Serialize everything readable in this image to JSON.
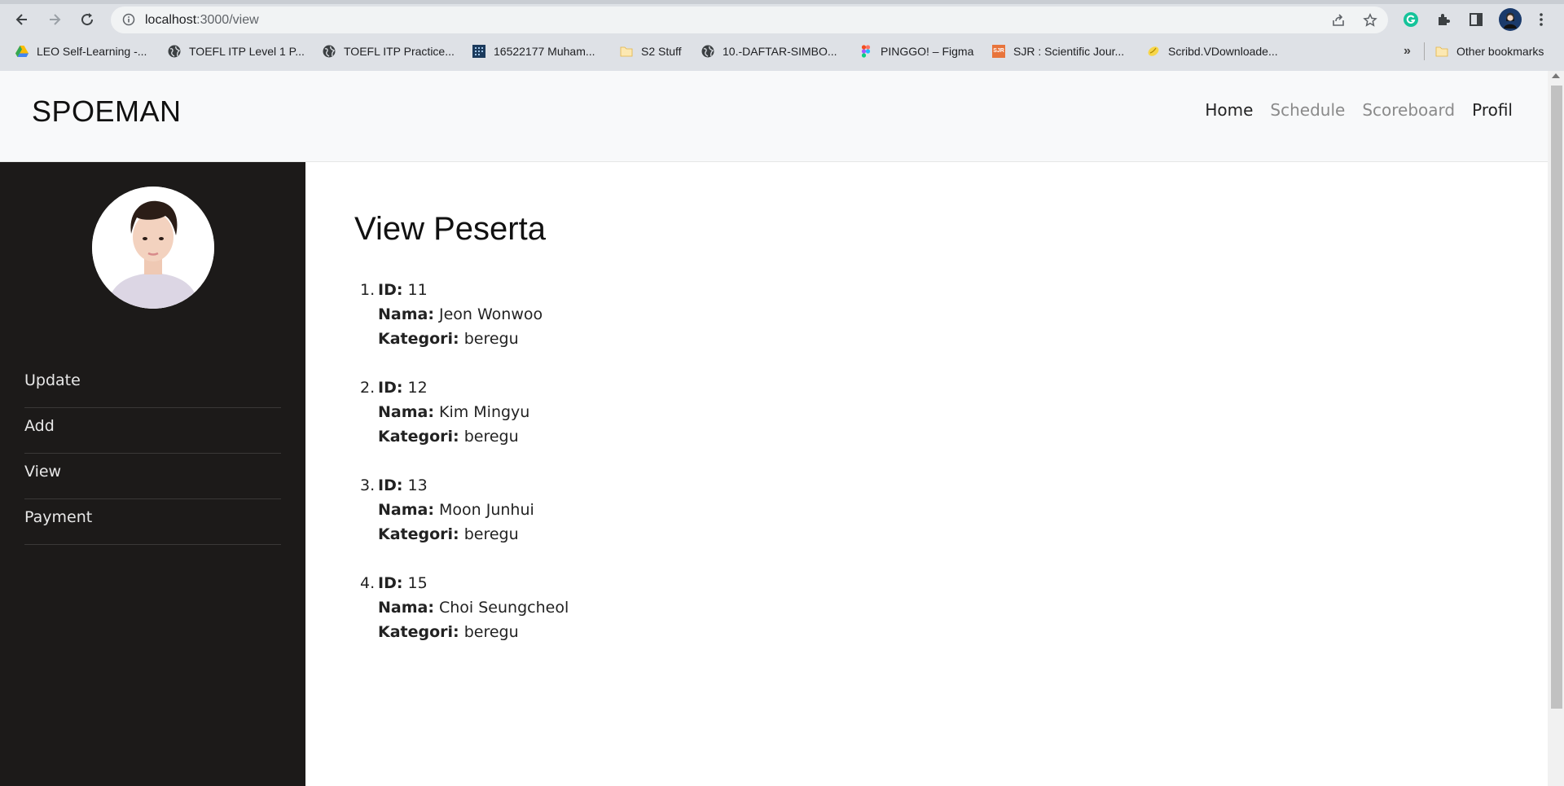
{
  "browser": {
    "url_host": "localhost",
    "url_path": ":3000/view",
    "bookmarks": [
      {
        "label": "LEO Self-Learning -...",
        "icon": "google-drive-icon"
      },
      {
        "label": "TOEFL ITP Level 1 P...",
        "icon": "globe-icon"
      },
      {
        "label": "TOEFL ITP Practice...",
        "icon": "globe-icon"
      },
      {
        "label": "16522177 Muham...",
        "icon": "grid-icon"
      },
      {
        "label": "S2 Stuff",
        "icon": "folder-icon"
      },
      {
        "label": "10.-DAFTAR-SIMBO...",
        "icon": "globe-icon"
      },
      {
        "label": "PINGGO! – Figma",
        "icon": "figma-icon"
      },
      {
        "label": "SJR : Scientific Jour...",
        "icon": "sjr-icon"
      },
      {
        "label": "Scribd.VDownloade...",
        "icon": "scribd-icon"
      }
    ],
    "more_bookmarks": "»",
    "other_bookmarks": "Other bookmarks",
    "sjr_badge": "SJR"
  },
  "header": {
    "brand": "SPOEMAN",
    "nav": [
      {
        "label": "Home",
        "active": true
      },
      {
        "label": "Schedule",
        "active": false
      },
      {
        "label": "Scoreboard",
        "active": false
      },
      {
        "label": "Profil",
        "active": true
      }
    ]
  },
  "sidebar": {
    "items": [
      {
        "label": "Update"
      },
      {
        "label": "Add"
      },
      {
        "label": "View"
      },
      {
        "label": "Payment"
      }
    ]
  },
  "main": {
    "title": "View Peserta",
    "field_labels": {
      "id": "ID:",
      "nama": "Nama:",
      "kategori": "Kategori:"
    },
    "peserta": [
      {
        "num": "1.",
        "id": "11",
        "nama": "Jeon Wonwoo",
        "kategori": "beregu"
      },
      {
        "num": "2.",
        "id": "12",
        "nama": "Kim Mingyu",
        "kategori": "beregu"
      },
      {
        "num": "3.",
        "id": "13",
        "nama": "Moon Junhui",
        "kategori": "beregu"
      },
      {
        "num": "4.",
        "id": "15",
        "nama": "Choi Seungcheol",
        "kategori": "beregu"
      }
    ]
  },
  "colors": {
    "sidebar_bg": "#1c1a19",
    "header_bg": "#f8f9fa",
    "grammarly": "#15c39a",
    "profile_avatar": "#1a3a6b"
  }
}
